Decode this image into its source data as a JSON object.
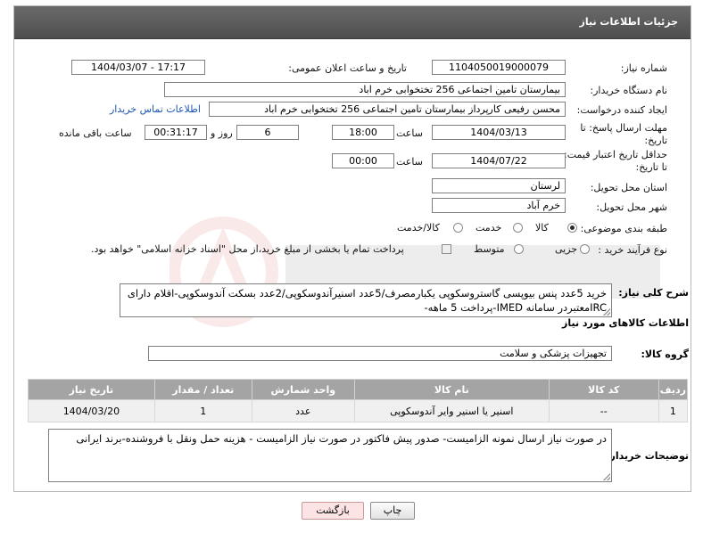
{
  "header": {
    "title": "جزئیات اطلاعات نیاز"
  },
  "labels": {
    "need_number": "شماره نیاز:",
    "announce_datetime": "تاریخ و ساعت اعلان عمومی:",
    "buyer_org": "نام دستگاه خریدار:",
    "requester": "ایجاد کننده درخواست:",
    "reply_deadline_line1": "مهلت ارسال پاسخ: تا",
    "reply_deadline_line2": "تاریخ:",
    "price_validity_line1": "حداقل تاریخ اعتبار قیمت:",
    "price_validity_line2": "تا تاریخ:",
    "hour": "ساعت",
    "days_and": "روز و",
    "hours_remaining": "ساعت باقی مانده",
    "delivery_province": "استان محل تحویل:",
    "delivery_city": "شهر محل تحویل:",
    "category": "طبقه بندی موضوعی:",
    "purchase_type": "نوع فرآیند خرید :",
    "description": "شرح کلی نیاز:",
    "goods_info": "اطلاعات کالاهای مورد نیاز",
    "goods_group": "گروه کالا:",
    "buyer_notes": "توضیحات خریدار:"
  },
  "fields": {
    "need_number": "1104050019000079",
    "announce_datetime": "1404/03/07 - 17:17",
    "buyer_org": "بیمارستان تامین اجتماعی  256 تختخوابی خرم اباد",
    "requester": "محسن رفیعی کارپرداز بیمارستان تامین اجتماعی  256 تختخوابی خرم اباد",
    "contact_link": "اطلاعات تماس خریدار",
    "reply_date": "1404/03/13",
    "reply_time": "18:00",
    "remaining_days": "6",
    "remaining_time": "00:31:17",
    "validity_date": "1404/07/22",
    "validity_time": "00:00",
    "province": "لرستان",
    "city": "خرم آباد",
    "description": "خرید 5عدد پنس بیوپسی گاستروسکوپی یکبارمصرف/5عدد اسنیرآندوسکوپی/2عدد بسکت آندوسکوپی-اقلام دارای IRCمعتبردر سامانه IMED-پرداخت 5 ماهه-",
    "goods_group": "تجهیزات پزشکی و سلامت",
    "buyer_notes": "در صورت نیاز ارسال نمونه الزامیست- صدور پیش فاکتور در صورت نیاز الزامیست - هزینه حمل ونقل با فروشنده-برند ایرانی"
  },
  "category_options": [
    {
      "label": "کالا",
      "selected": true
    },
    {
      "label": "خدمت",
      "selected": false
    },
    {
      "label": "کالا/خدمت",
      "selected": false
    }
  ],
  "purchase_options": [
    {
      "label": "جزیی",
      "selected": false
    },
    {
      "label": "متوسط",
      "selected": false
    }
  ],
  "payment_note": "پرداخت تمام یا بخشی از مبلغ خرید،از محل \"اسناد خزانه اسلامی\" خواهد بود.",
  "table": {
    "headers": [
      "ردیف",
      "کد کالا",
      "نام کالا",
      "واحد شمارش",
      "تعداد / مقدار",
      "تاریخ نیاز"
    ],
    "rows": [
      [
        "1",
        "--",
        "اسنیر یا اسنیر وایر آندوسکوپی",
        "عدد",
        "1",
        "1404/03/20"
      ]
    ]
  },
  "buttons": {
    "print": "چاپ",
    "back": "بازگشت"
  },
  "colors": {
    "header_bg": "#5a5a5a",
    "table_header": "#a4a4a4",
    "back_button_bg": "#fde4e4",
    "link": "#1a55b5"
  }
}
